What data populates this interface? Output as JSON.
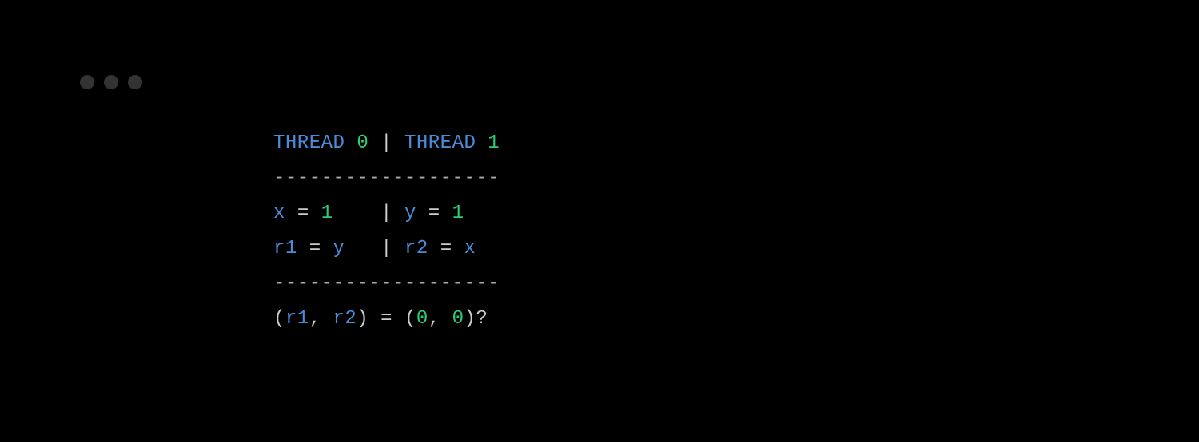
{
  "header": {
    "thread0": "THREAD",
    "thread0num": "0",
    "sep": "|",
    "thread1": "THREAD",
    "thread1num": "1"
  },
  "divider": "-------------------",
  "row1": {
    "x": "x",
    "eq1": "=",
    "one1": "1",
    "pad1": "    ",
    "sep": "|",
    "y": "y",
    "eq2": "=",
    "one2": "1"
  },
  "row2": {
    "r1": "r1",
    "eq1": "=",
    "y": "y",
    "pad1": "   ",
    "sep": "|",
    "r2": "r2",
    "eq2": "=",
    "x": "x"
  },
  "result": {
    "open": "(",
    "r1": "r1",
    "comma": ",",
    "r2": "r2",
    "close": ")",
    "eq": "=",
    "open2": "(",
    "zero1": "0",
    "comma2": ",",
    "zero2": "0",
    "close2": ")",
    "q": "?"
  }
}
